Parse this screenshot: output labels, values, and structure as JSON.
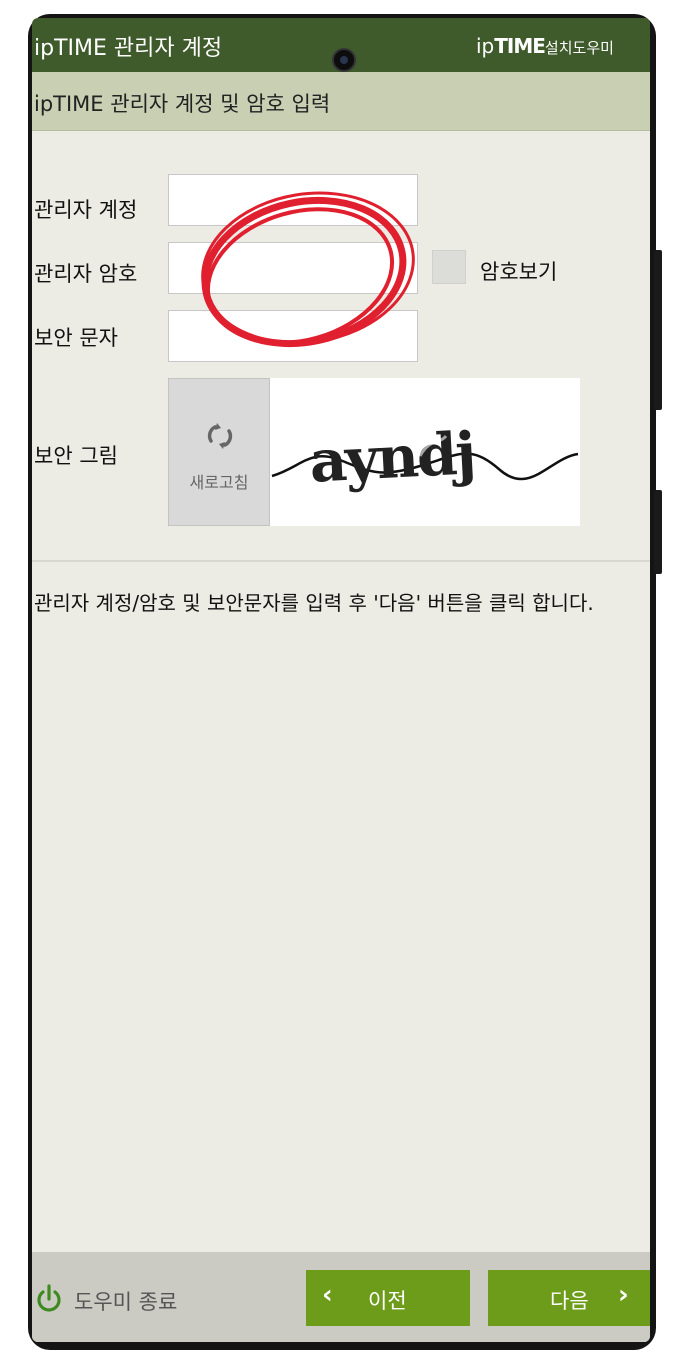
{
  "titlebar": {
    "title": "ipTIME 관리자 계정",
    "brand_ip": "ip",
    "brand_time": "TIME",
    "brand_suffix": "설치도우미"
  },
  "subheader": "ipTIME 관리자 계정 및 암호 입력",
  "form": {
    "account_label": "관리자 계정",
    "password_label": "관리자 암호",
    "security_text_label": "보안 문자",
    "show_password_label": "암호보기",
    "security_image_label": "보안 그림",
    "refresh_label": "새로고침",
    "captcha_text": "ayndj"
  },
  "description": "관리자 계정/암호 및 보안문자를 입력 후 '다음' 버튼을 클릭 합니다.",
  "bottom": {
    "exit_label": "도우미 종료",
    "prev_label": "이전",
    "next_label": "다음"
  },
  "colors": {
    "titlebar": "#3f5a2b",
    "subbar": "#c8cfb3",
    "button": "#6d9c1a",
    "annotation": "#e0202e"
  }
}
